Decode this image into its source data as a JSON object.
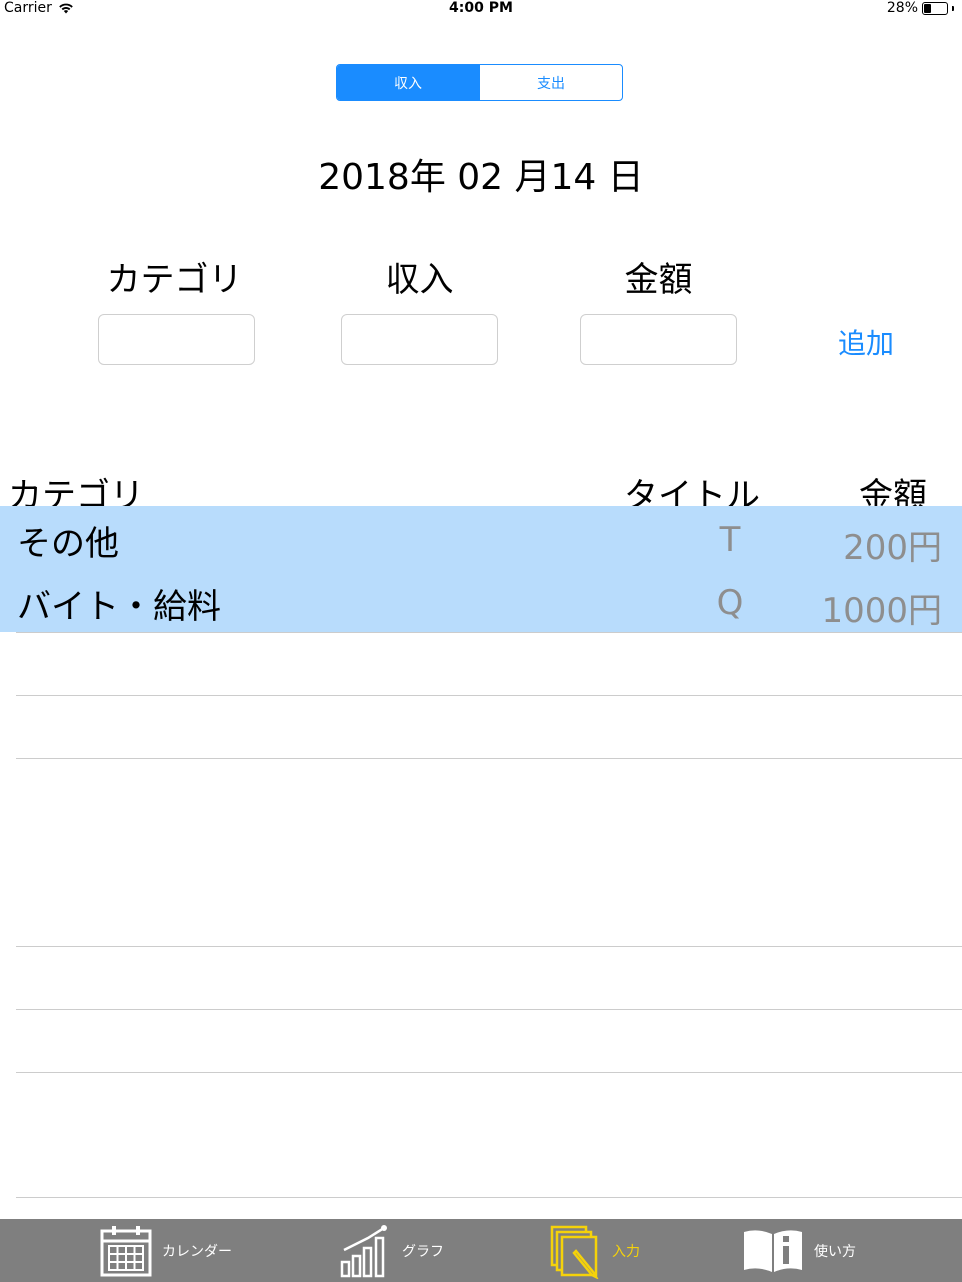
{
  "status_bar": {
    "carrier": "Carrier",
    "time": "4:00 PM",
    "battery": "28%"
  },
  "segmented": {
    "income": "収入",
    "expense": "支出",
    "selected": "収入"
  },
  "date": "2018年 02 月14 日",
  "form": {
    "category_label": "カテゴリ",
    "type_label": "収入",
    "amount_label": "金額",
    "add_button": "追加"
  },
  "table": {
    "headers": {
      "category": "カテゴリ",
      "title": "タイトル",
      "amount": "金額"
    },
    "rows": [
      {
        "category": "その他",
        "title": "T",
        "amount": "200円"
      },
      {
        "category": "バイト・給料",
        "title": "Q",
        "amount": "1000円"
      }
    ]
  },
  "tab_bar": {
    "tabs": [
      {
        "label": "カレンダー",
        "icon": "calendar-icon"
      },
      {
        "label": "グラフ",
        "icon": "bar-chart-icon"
      },
      {
        "label": "入力",
        "icon": "input-pencil-icon",
        "active": true
      },
      {
        "label": "使い方",
        "icon": "info-book-icon"
      }
    ]
  },
  "colors": {
    "accent": "#1a8cff",
    "selected_row": "#b8dcfc",
    "tab_bar": "#7f7f7f",
    "active_tab": "#f5d20a"
  }
}
